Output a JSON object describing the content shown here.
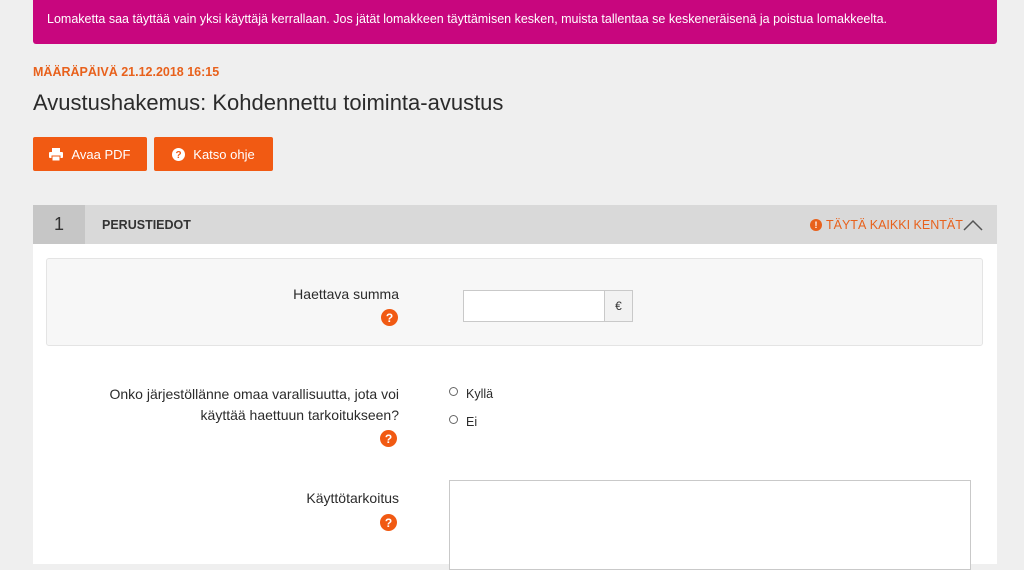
{
  "notice": {
    "text": "Lomaketta saa täyttää vain yksi käyttäjä kerrallaan. Jos jätät lomakkeen täyttämisen kesken, muista tallentaa se keskeneräisenä ja poistua lomakkeelta."
  },
  "deadline": "MÄÄRÄPÄIVÄ 21.12.2018 16:15",
  "title": "Avustushakemus: Kohdennettu toiminta-avustus",
  "buttons": {
    "pdf": {
      "label": "Avaa PDF",
      "icon": "printer-icon"
    },
    "help": {
      "label": "Katso ohje",
      "icon": "question-circle-icon"
    }
  },
  "section": {
    "number": "1",
    "title": "PERUSTIEDOT",
    "status": "TÄYTÄ KAIKKI KENTÄT",
    "status_icon": "!",
    "collapse_icon": "chevron-up-icon"
  },
  "fields": {
    "amount": {
      "label": "Haettava summa",
      "value": "",
      "currency": "€"
    },
    "wealth": {
      "label_line1": "Onko järjestöllänne omaa varallisuutta, jota voi",
      "label_line2": "käyttää haettuun tarkoitukseen?",
      "options": [
        "Kyllä",
        "Ei"
      ]
    },
    "purpose": {
      "label": "Käyttötarkoitus",
      "value": ""
    }
  },
  "help_symbol": "?",
  "colors": {
    "notice_bg": "#c8067e",
    "accent": "#f15a13",
    "deadline": "#e8611c"
  }
}
